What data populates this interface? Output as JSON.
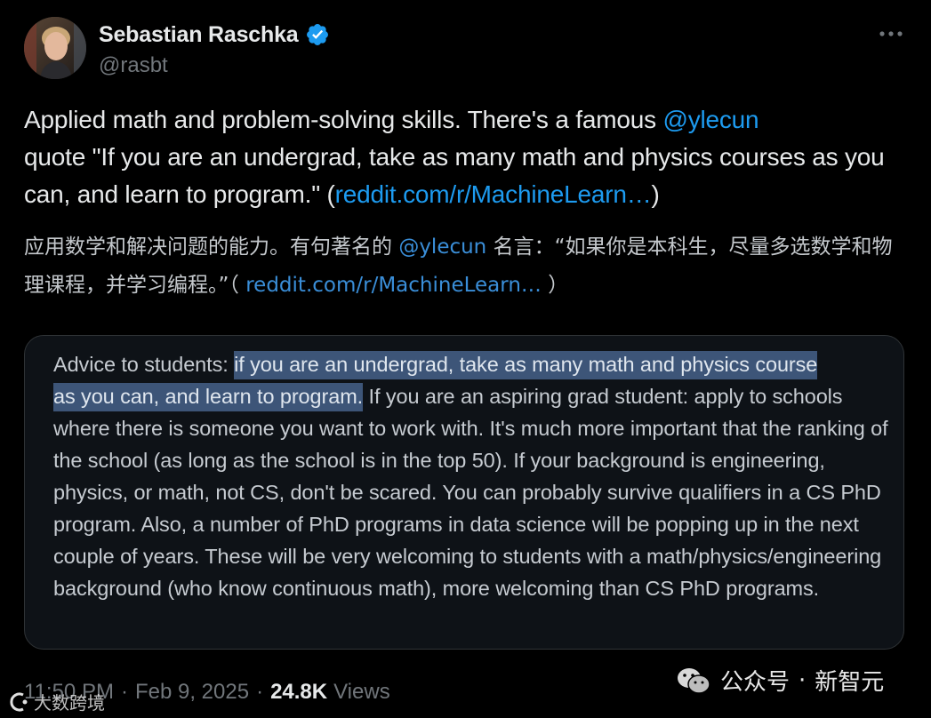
{
  "author": {
    "name": "Sebastian Raschka",
    "handle": "@rasbt"
  },
  "tweet": {
    "line1_prefix": "Applied math and problem-solving skills. There's a famous ",
    "mention": "@ylecun",
    "line2_plain": "quote \"If you are an undergrad, take as many math and physics courses as you can, and learn to program.\" (",
    "link": "reddit.com/r/MachineLearn…",
    "link_suffix": ")"
  },
  "translation": {
    "prefix": "应用数学和解决问题的能力。有句著名的 ",
    "mention": "@ylecun",
    "middle": " 名言：“如果你是本科生，尽量多选数学和物理课程，并学习编程。”（ ",
    "link": "reddit.com/r/MachineLearn…",
    "suffix": " ）"
  },
  "quote": {
    "lead": "Advice to students: ",
    "highlight_1": "if you are an undergrad, take as many math and physics course",
    "highlight_2": "as you can, and learn to program.",
    "rest": " If you are an aspiring grad student: apply to schools where there is someone you want to work with. It's much more important that the ranking of the school (as long as the school is in the top 50). If your background is engineering, physics, or math, not CS, don't be scared. You can probably survive qualifiers in a CS PhD program. Also, a number of PhD programs in data science will be popping up in the next couple of years. These will be very welcoming to students with a math/physics/engineering background (who know continuous math), more welcoming than CS PhD programs."
  },
  "meta": {
    "time": "11:50 PM",
    "separator": "·",
    "date": "Feb 9, 2025",
    "views_count": "24.8K",
    "views_label": "Views"
  },
  "watermarks": {
    "left": "大数跨境",
    "right_service": "公众号",
    "right_dot": "·",
    "right_name": "新智元"
  },
  "colors": {
    "background": "#000000",
    "link": "#1d9bf0",
    "verified_badge": "#1d9bf0",
    "highlight": "#3d5578",
    "secondary_text": "#71767b"
  },
  "icons": [
    "verified-badge-icon",
    "more-options-icon",
    "wechat-logo-icon",
    "watermark-logo-icon"
  ]
}
